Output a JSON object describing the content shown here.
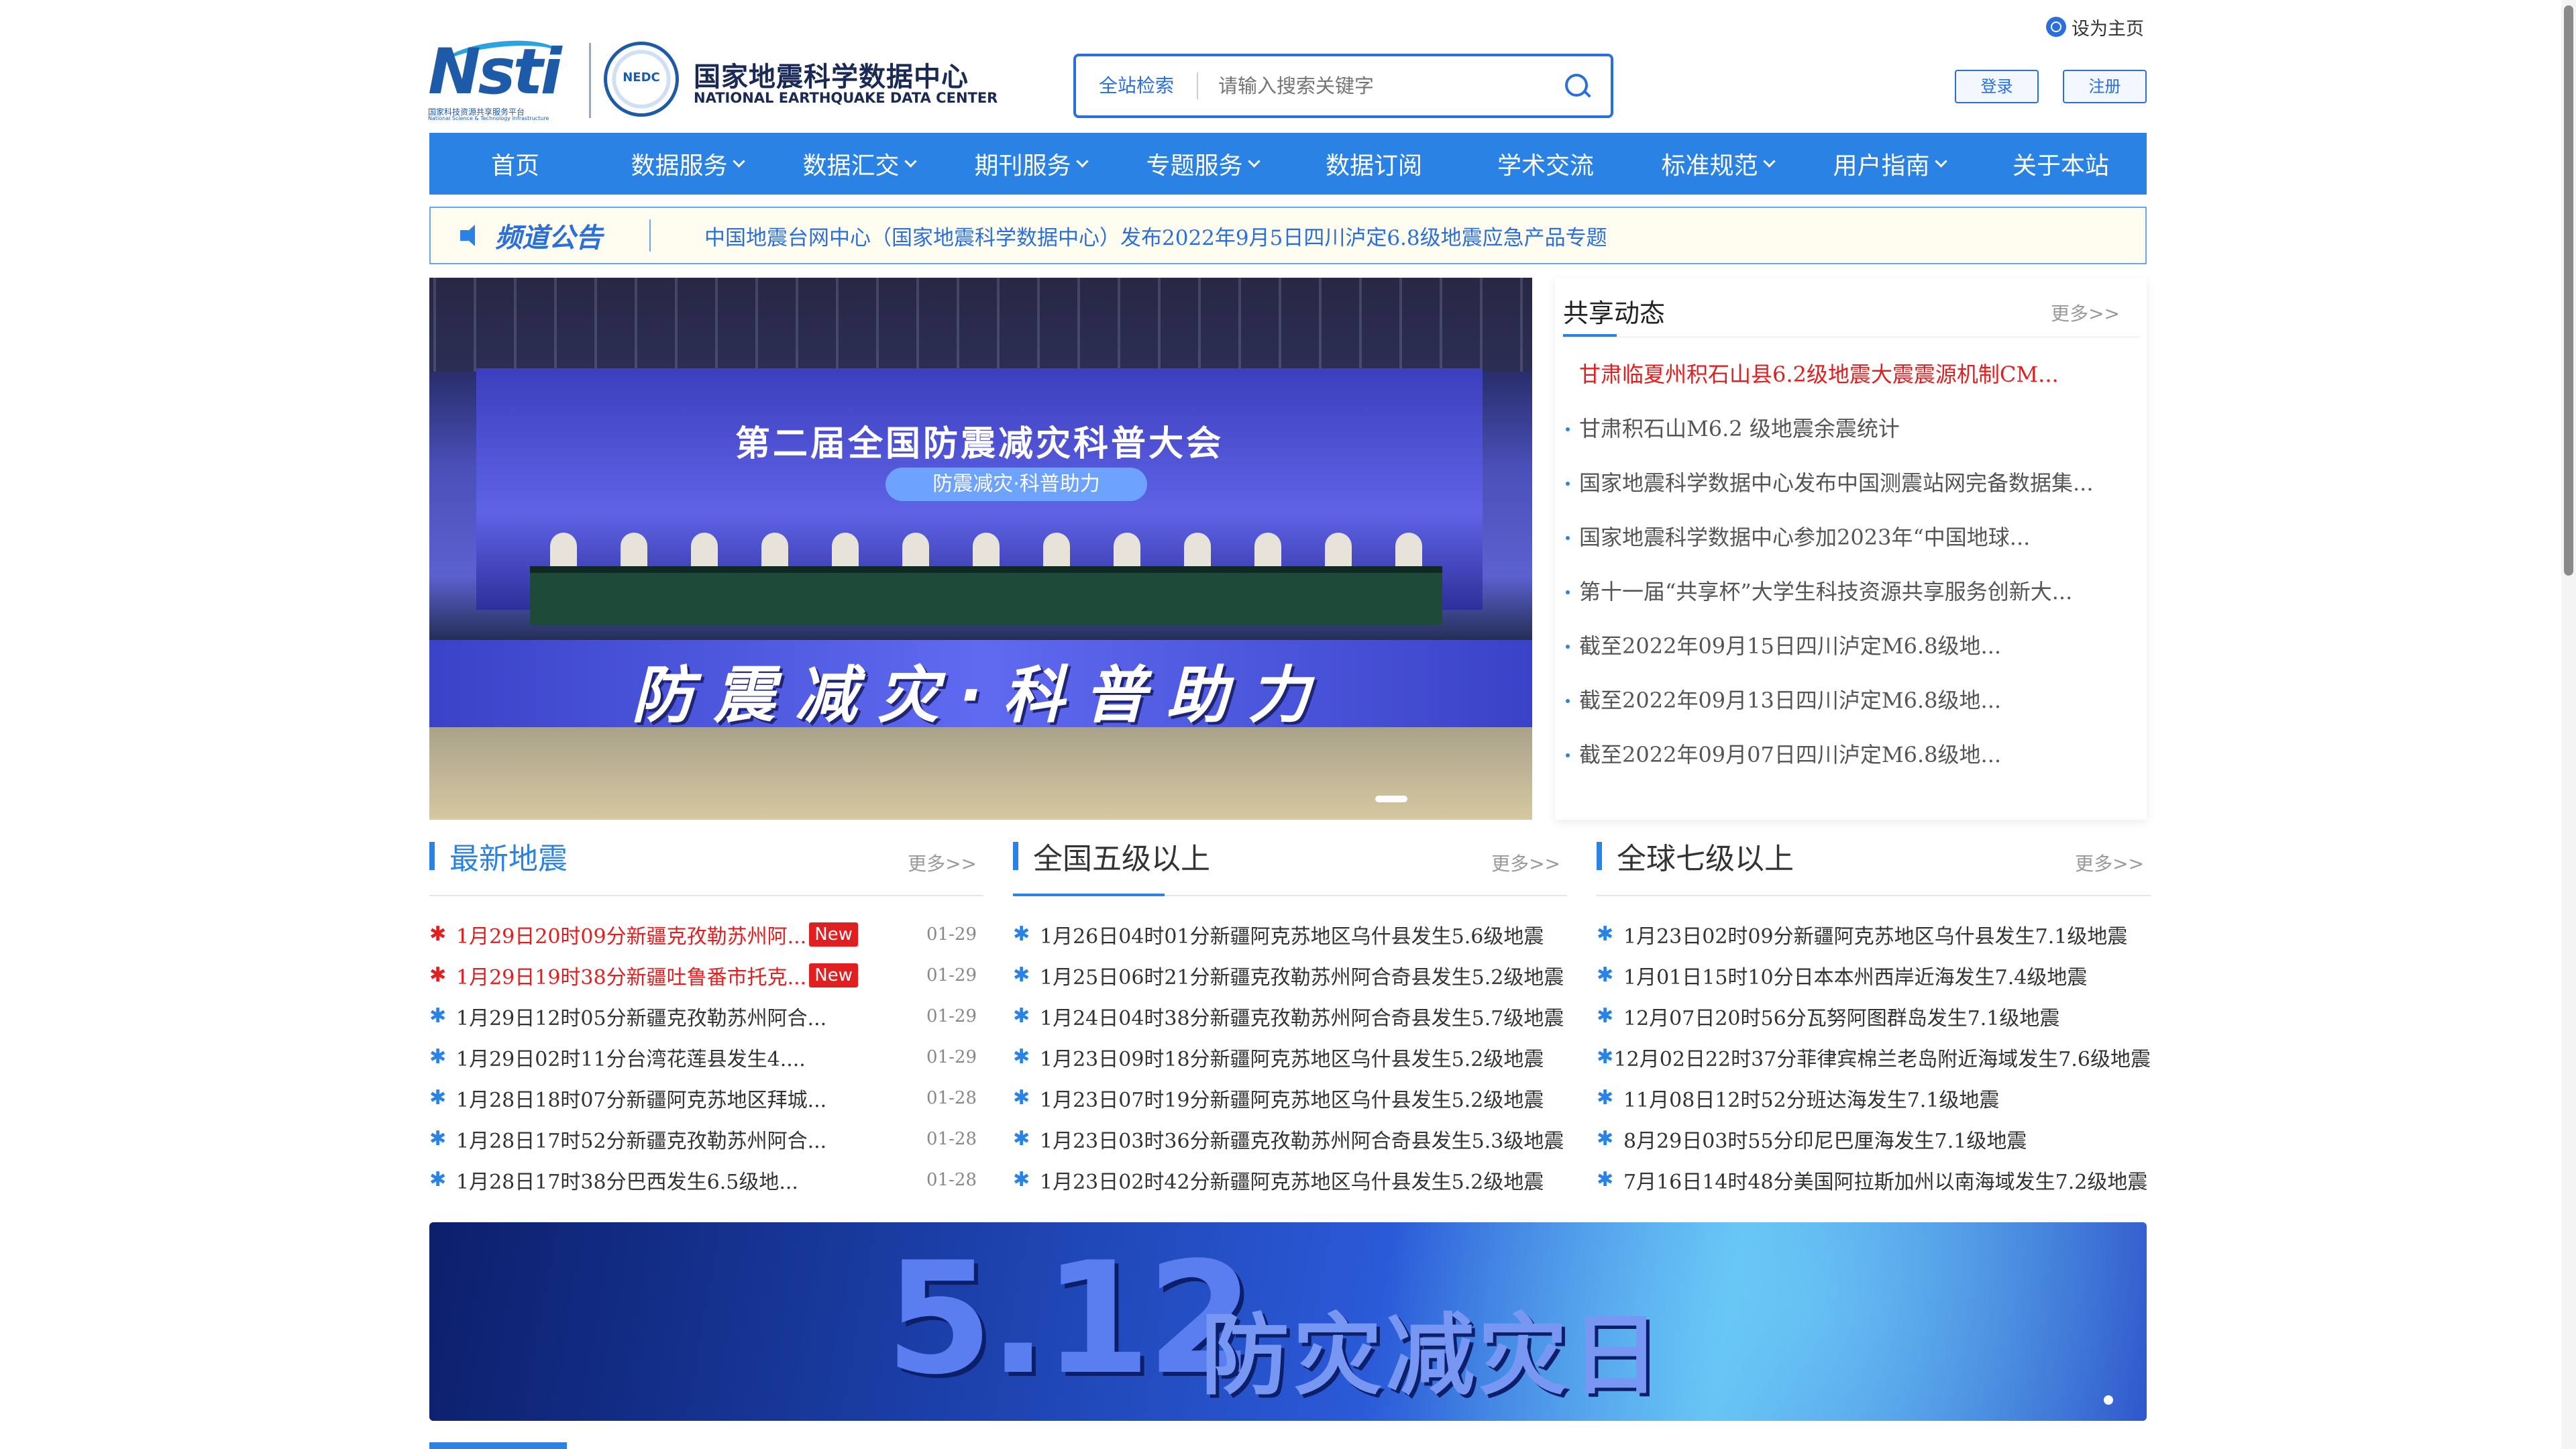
{
  "topbar": {
    "set_home": "设为主页"
  },
  "logo": {
    "nsti_word": "Nsti",
    "nsti_sub_cn": "国家科技资源共享服务平台",
    "nsti_sub_en": "National Science & Technology Infrastructure",
    "seal_text": "NEDC",
    "name_cn": "国家地震科学数据中心",
    "name_en": "NATIONAL EARTHQUAKE DATA CENTER"
  },
  "search": {
    "scope": "全站检索",
    "placeholder": "请输入搜索关键字"
  },
  "auth": {
    "login": "登录",
    "register": "注册"
  },
  "nav": {
    "items": [
      {
        "label": "首页"
      },
      {
        "label": "数据服务"
      },
      {
        "label": "数据汇交"
      },
      {
        "label": "期刊服务"
      },
      {
        "label": "专题服务"
      },
      {
        "label": "数据订阅"
      },
      {
        "label": "学术交流"
      },
      {
        "label": "标准规范"
      },
      {
        "label": "用户指南"
      },
      {
        "label": "关于本站"
      }
    ]
  },
  "notice": {
    "title": "频道公告",
    "text": "中国地震台网中心（国家地震科学数据中心）发布2022年9月5日四川泸定6.8级地震应急产品专题"
  },
  "banner": {
    "screen_title": "第二届全国防震减灾科普大会",
    "screen_sub": "防震减灾·科普助力",
    "led_text": "防震减灾·科普助力"
  },
  "share": {
    "title": "共享动态",
    "more": "更多>>",
    "items": [
      "甘肃临夏州积石山县6.2级地震大震震源机制CM...",
      "甘肃积石山M6.2 级地震余震统计",
      "国家地震科学数据中心发布中国测震站网完备数据集...",
      "国家地震科学数据中心参加2023年“中国地球...",
      "第十一届“共享杯”大学生科技资源共享服务创新大...",
      "截至2022年09月15日四川泸定M6.8级地...",
      "截至2022年09月13日四川泸定M6.8级地...",
      "截至2022年09月07日四川泸定M6.8级地..."
    ]
  },
  "latest": {
    "title": "最新地震",
    "more": "更多>>",
    "new_tag": "New",
    "items": [
      {
        "text": "1月29日20时09分新疆克孜勒苏州阿...",
        "date": "01-29"
      },
      {
        "text": "1月29日19时38分新疆吐鲁番市托克...",
        "date": "01-29"
      },
      {
        "text": "1月29日12时05分新疆克孜勒苏州阿合...",
        "date": "01-29"
      },
      {
        "text": "1月29日02时11分台湾花莲县发生4....",
        "date": "01-29"
      },
      {
        "text": "1月28日18时07分新疆阿克苏地区拜城...",
        "date": "01-28"
      },
      {
        "text": "1月28日17时52分新疆克孜勒苏州阿合...",
        "date": "01-28"
      },
      {
        "text": "1月28日17时38分巴西发生6.5级地...",
        "date": "01-28"
      }
    ]
  },
  "national": {
    "title": "全国五级以上",
    "more": "更多>>",
    "items": [
      "1月26日04时01分新疆阿克苏地区乌什县发生5.6级地震",
      "1月25日06时21分新疆克孜勒苏州阿合奇县发生5.2级地震",
      "1月24日04时38分新疆克孜勒苏州阿合奇县发生5.7级地震",
      "1月23日09时18分新疆阿克苏地区乌什县发生5.2级地震",
      "1月23日07时19分新疆阿克苏地区乌什县发生5.2级地震",
      "1月23日03时36分新疆克孜勒苏州阿合奇县发生5.3级地震",
      "1月23日02时42分新疆阿克苏地区乌什县发生5.2级地震"
    ]
  },
  "global": {
    "title": "全球七级以上",
    "more": "更多>>",
    "items": [
      "1月23日02时09分新疆阿克苏地区乌什县发生7.1级地震",
      "1月01日15时10分日本本州西岸近海发生7.4级地震",
      "12月07日20时56分瓦努阿图群岛发生7.1级地震",
      "12月02日22时37分菲律宾棉兰老岛附近海域发生7.6级地震",
      "11月08日12时52分班达海发生7.1级地震",
      "8月29日03时55分印尼巴厘海发生7.1级地震",
      "7月16日14时48分美国阿拉斯加州以南海域发生7.2级地震"
    ]
  },
  "banner2": {
    "big": "5.12",
    "cn": "防灾减灾日"
  },
  "colors": {
    "primary": "#2a82e4",
    "alert": "#e02020"
  }
}
